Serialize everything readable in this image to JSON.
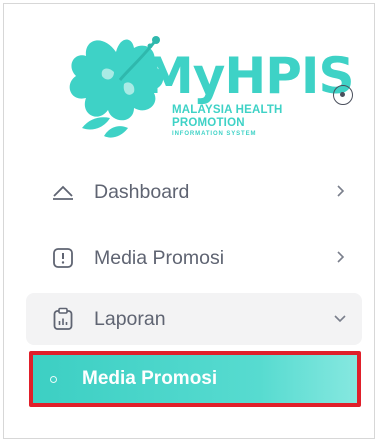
{
  "logo": {
    "title": "MyHPIS",
    "line1": "MALAYSIA HEALTH",
    "line2": "PROMOTION",
    "line3": "INFORMATION SYSTEM",
    "color": "#3ed2c6"
  },
  "toggle": {
    "icon": "radio-dot-icon"
  },
  "menu": {
    "items": [
      {
        "label": "Dashboard",
        "icon": "dashboard-icon",
        "chevron": "chevron-right-icon"
      },
      {
        "label": "Media Promosi",
        "icon": "alert-square-icon",
        "chevron": "chevron-right-icon"
      },
      {
        "label": "Laporan",
        "icon": "report-clipboard-icon",
        "chevron": "chevron-down-icon",
        "children": [
          {
            "label": "Media Promosi",
            "active": true
          }
        ]
      }
    ]
  },
  "colors": {
    "accent": "#3ed2c6",
    "highlight": "#e01f2a",
    "text": "#5f6472"
  }
}
